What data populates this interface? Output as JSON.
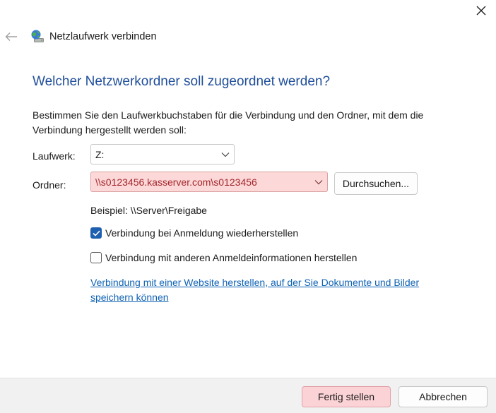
{
  "window": {
    "title": "Netzlaufwerk verbinden",
    "icon": "network-drive-icon"
  },
  "page": {
    "heading": "Welcher Netzwerkordner soll zugeordnet werden?",
    "instructions": "Bestimmen Sie den Laufwerkbuchstaben für die Verbindung und den Ordner, mit dem die Verbindung hergestellt werden soll:"
  },
  "drive": {
    "label": "Laufwerk:",
    "value": "Z:"
  },
  "folder": {
    "label": "Ordner:",
    "value": "\\\\s0123456.kasserver.com\\s0123456",
    "error_color": "#fcd8d8",
    "browse_label": "Durchsuchen..."
  },
  "example": "Beispiel: \\\\Server\\Freigabe",
  "options": [
    {
      "label": "Verbindung bei Anmeldung wiederherstellen",
      "checked": true
    },
    {
      "label": "Verbindung mit anderen Anmeldeinformationen herstellen",
      "checked": false
    }
  ],
  "link": "Verbindung mit einer Website herstellen, auf der Sie Dokumente und Bilder speichern können",
  "footer": {
    "finish_label": "Fertig stellen",
    "cancel_label": "Abbrechen"
  },
  "colors": {
    "heading": "#1f4e9a",
    "link": "#0f62b4",
    "checkbox": "#1f5fb0",
    "error_text": "#a4262c"
  }
}
